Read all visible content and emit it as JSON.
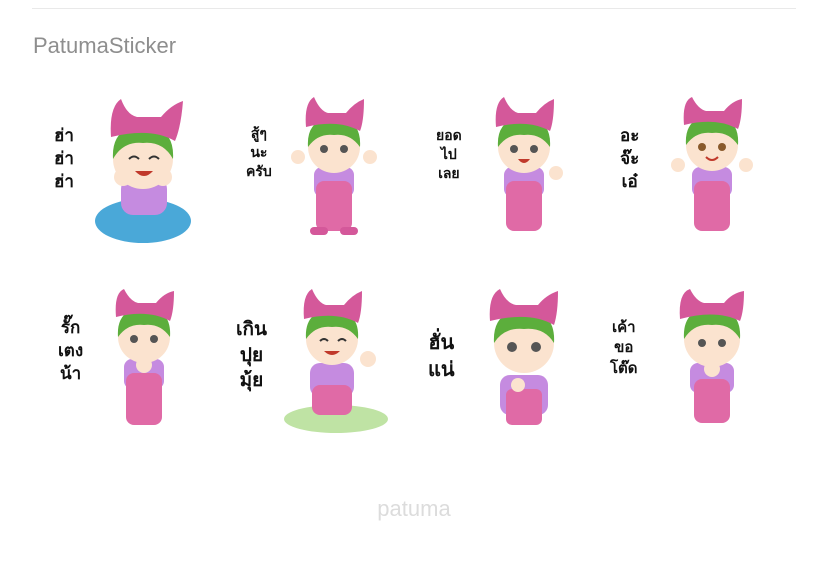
{
  "page": {
    "title": "PatumaSticker",
    "footer": "patuma"
  },
  "stickers": [
    {
      "caption": "ฮ่า\nฮ่า\nฮ่า",
      "icon": "boy-laughing-on-cushion"
    },
    {
      "caption": "สู้ๆ\nนะ\nครับ",
      "icon": "boy-fighting-pose"
    },
    {
      "caption": "ยอด\nไป\nเลย",
      "icon": "boy-thumbs-up"
    },
    {
      "caption": "อะ\nจ๊ะ\nเอ๋",
      "icon": "boy-peekaboo"
    },
    {
      "caption": "รั๊ก\nเตง\nน้า",
      "icon": "boy-love-hands"
    },
    {
      "caption": "เกิน\nปุย\nมุ้ย",
      "icon": "boy-crying-kneeling"
    },
    {
      "caption": "ฮั่น\nแน่",
      "icon": "boy-thinking"
    },
    {
      "caption": "เค้า\nขอ\nโต๊ด",
      "icon": "boy-apologizing"
    }
  ],
  "colors": {
    "hat": "#d4589a",
    "hair": "#5cae3c",
    "overalls": "#e06aa6",
    "shirt": "#c58be0",
    "skin": "#fbe3cf"
  }
}
